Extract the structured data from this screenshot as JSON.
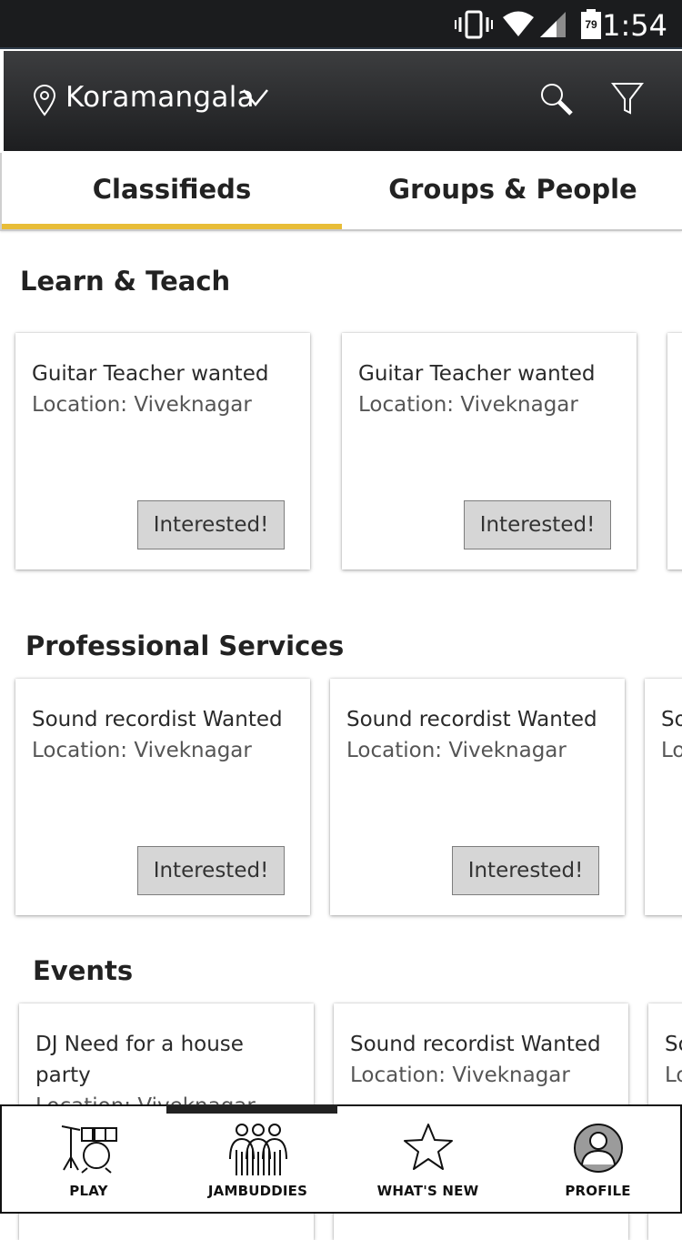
{
  "status_bar": {
    "time": "1:54",
    "battery_level": "79",
    "icons": [
      "vibrate-icon",
      "wifi-icon",
      "cell-signal-icon",
      "battery-icon"
    ]
  },
  "header": {
    "location": "Koramangala",
    "icons": [
      "location-pin-icon",
      "chevron-down-icon",
      "search-icon",
      "filter-icon"
    ]
  },
  "tabs": [
    {
      "label": "Classifieds",
      "active": true
    },
    {
      "label": "Groups & People",
      "active": false
    }
  ],
  "colors": {
    "accent": "#e8bd38",
    "header_dark": "#1d1e20",
    "button_bg": "#d6d6d6"
  },
  "sections": [
    {
      "title": "Learn & Teach",
      "cards": [
        {
          "title": "Guitar Teacher wanted",
          "location": "Location: Viveknagar",
          "button": "Interested!"
        },
        {
          "title": "Guitar Teacher wanted",
          "location": "Location: Viveknagar",
          "button": "Interested!"
        }
      ]
    },
    {
      "title": "Professional Services",
      "cards": [
        {
          "title": "Sound recordist Wanted",
          "location": "Location: Viveknagar",
          "button": "Interested!"
        },
        {
          "title": "Sound recordist Wanted",
          "location": "Location: Viveknagar",
          "button": "Interested!"
        },
        {
          "title": "So",
          "location": "Lo"
        }
      ]
    },
    {
      "title": "Events",
      "cards": [
        {
          "title": "DJ Need for a house party",
          "location": "Location: Viveknagar"
        },
        {
          "title": "Sound recordist Wanted",
          "location": "Location: Viveknagar"
        },
        {
          "title": "So",
          "location": "Lo"
        }
      ]
    }
  ],
  "bottom_nav": [
    {
      "label": "PLAY",
      "icon": "drum-kit-icon",
      "active": false
    },
    {
      "label": "JAMBUDDIES",
      "icon": "people-group-icon",
      "active": true
    },
    {
      "label": "WHAT'S NEW",
      "icon": "star-icon",
      "active": false
    },
    {
      "label": "PROFILE",
      "icon": "profile-avatar-icon",
      "active": false
    }
  ]
}
